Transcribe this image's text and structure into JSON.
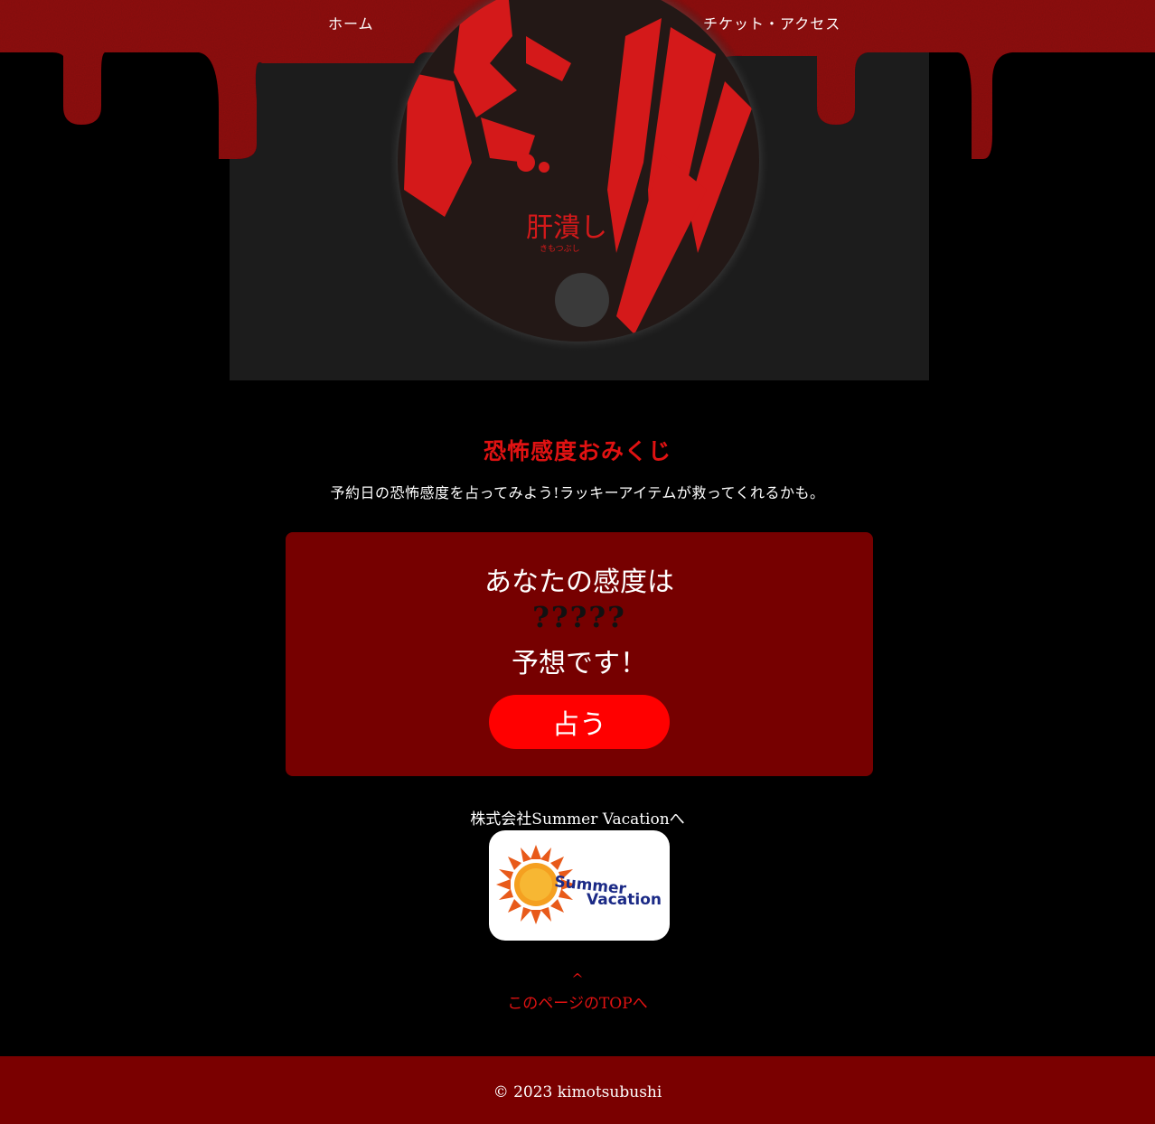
{
  "nav": {
    "home_label": "ホーム",
    "ticket_label": "チケット・アクセス"
  },
  "hero": {
    "logo_text": "肝潰し",
    "logo_sub": "きもつぶし"
  },
  "omikuji": {
    "title": "恐怖感度おみくじ",
    "description": "予約日の恐怖感度を占ってみよう!ラッキーアイテムが救ってくれるかも。",
    "line1": "あなたの感度は",
    "result": "?????",
    "line3": "予想です！",
    "button_label": "占う"
  },
  "company": {
    "link_label": "株式会社Summer Vacationへ",
    "logo_word1": "Summer",
    "logo_word2": "Vacation"
  },
  "back_to_top": {
    "arrow": "^",
    "label": "このページのTOPへ"
  },
  "footer": {
    "copyright": "© 2023 kimotsubushi"
  },
  "colors": {
    "accent_red": "#e01212",
    "box_bg": "#760000",
    "button_bg": "#ff0000",
    "footer_bg": "#7a0000"
  }
}
